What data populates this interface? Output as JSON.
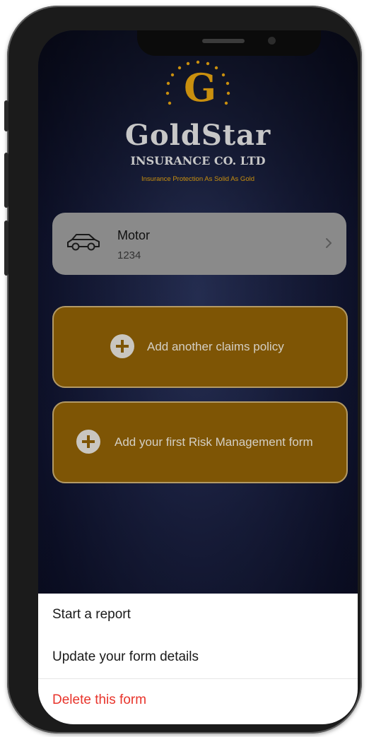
{
  "brand": {
    "initial": "G",
    "name": "GoldStar",
    "subtitle": "INSURANCE CO. LTD",
    "tagline": "Insurance Protection As Solid As Gold"
  },
  "policy": {
    "icon": "car-icon",
    "name": "Motor",
    "number": "1234"
  },
  "actions": {
    "add_claims_policy": "Add another claims policy",
    "add_risk_form": "Add your first Risk Management form"
  },
  "sheet": {
    "items": [
      {
        "label": "Start a report"
      },
      {
        "label": "Update your form details"
      },
      {
        "label": "Delete this form"
      }
    ]
  },
  "colors": {
    "gold": "#7e5505",
    "brand_gold": "#c98f0e",
    "danger": "#e8342b"
  }
}
